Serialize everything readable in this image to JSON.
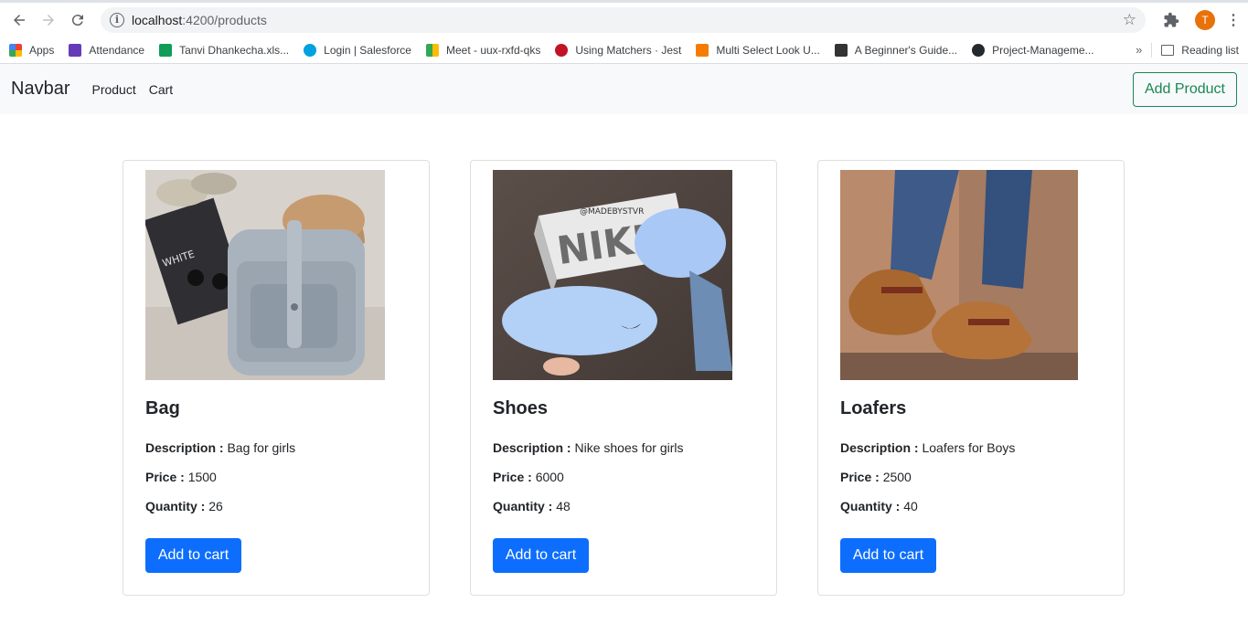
{
  "browser": {
    "url_host": "localhost",
    "url_rest": ":4200/products",
    "avatar_letter": "T",
    "bookmarks": [
      {
        "label": "Apps",
        "color": "#4285f4"
      },
      {
        "label": "Attendance",
        "color": "#673ab7"
      },
      {
        "label": "Tanvi Dhankecha.xls...",
        "color": "#0f9d58"
      },
      {
        "label": "Login | Salesforce",
        "color": "#00a1e0"
      },
      {
        "label": "Meet - uux-rxfd-qks",
        "color": "#00897b"
      },
      {
        "label": "Using Matchers · Jest",
        "color": "#c21325"
      },
      {
        "label": "Multi Select Look U...",
        "color": "#f57c00"
      },
      {
        "label": "A Beginner's Guide...",
        "color": "#333333"
      },
      {
        "label": "Project-Manageme...",
        "color": "#24292e"
      }
    ],
    "more_label": "»",
    "reading_list": "Reading list"
  },
  "navbar": {
    "brand": "Navbar",
    "links": [
      "Product",
      "Cart"
    ],
    "add_product": "Add Product"
  },
  "products": [
    {
      "name": "Bag",
      "description_label": "Description :",
      "description": "Bag for girls",
      "price_label": "Price :",
      "price": "1500",
      "quantity_label": "Quantity :",
      "quantity": "26",
      "button": "Add to cart",
      "image_text": ""
    },
    {
      "name": "Shoes",
      "description_label": "Description :",
      "description": "Nike shoes for girls",
      "price_label": "Price :",
      "price": "6000",
      "quantity_label": "Quantity :",
      "quantity": "48",
      "button": "Add to cart",
      "image_text": "@MADEBYSTVR"
    },
    {
      "name": "Loafers",
      "description_label": "Description :",
      "description": "Loafers for Boys",
      "price_label": "Price :",
      "price": "2500",
      "quantity_label": "Quantity :",
      "quantity": "40",
      "button": "Add to cart",
      "image_text": ""
    }
  ],
  "colors": {
    "primary": "#0d6efd",
    "success": "#198754",
    "navbar_bg": "#f8f9fa"
  }
}
